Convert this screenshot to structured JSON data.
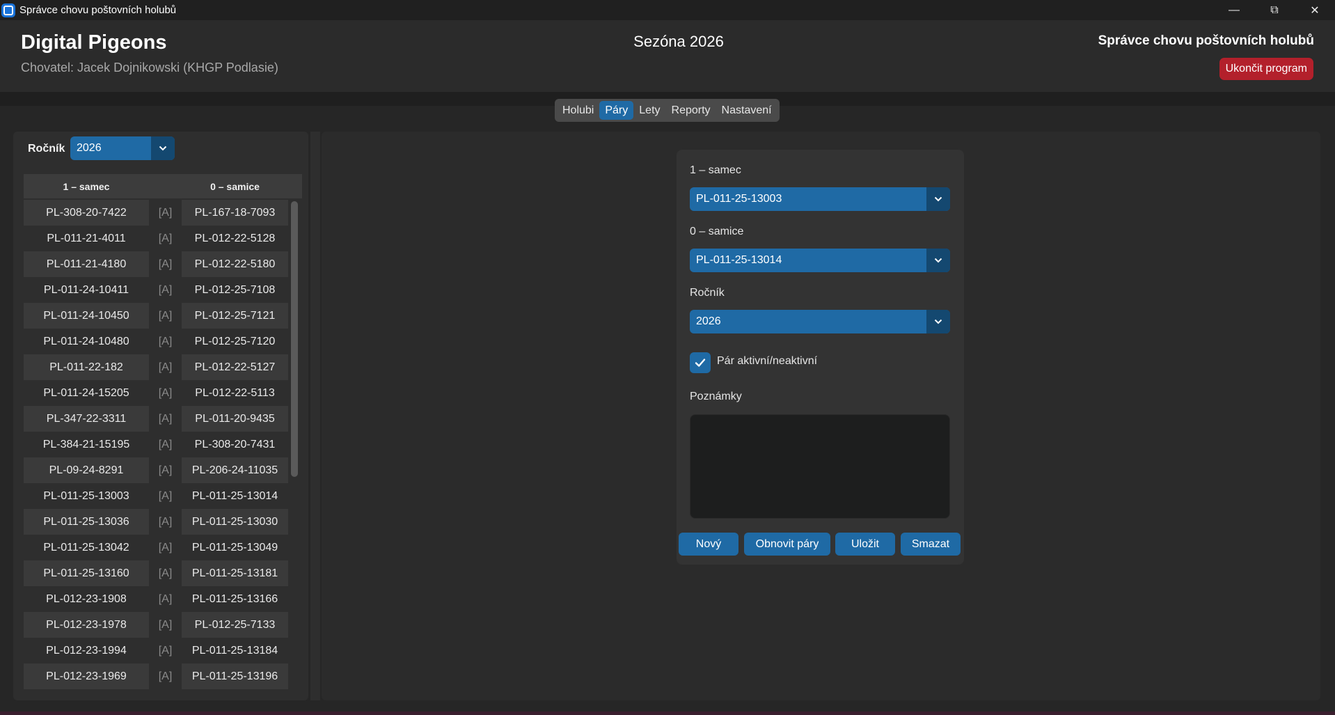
{
  "window": {
    "title": "Správce chovu poštovních holubů"
  },
  "header": {
    "brand": "Digital Pigeons",
    "breeder": "Chovatel: Jacek Dojnikowski (KHGP Podlasie)",
    "season": "Sezóna 2026",
    "app_title": "Správce chovu poštovních holubů",
    "exit_label": "Ukončit program"
  },
  "tabs": [
    {
      "label": "Holubi",
      "active": false
    },
    {
      "label": "Páry",
      "active": true
    },
    {
      "label": "Lety",
      "active": false
    },
    {
      "label": "Reporty",
      "active": false
    },
    {
      "label": "Nastavení",
      "active": false
    }
  ],
  "filter": {
    "label": "Ročník",
    "value": "2026"
  },
  "table": {
    "headers": [
      "1 – samec",
      "0 – samice"
    ],
    "rows": [
      [
        "PL-308-20-7422",
        "[A]",
        "PL-167-18-7093"
      ],
      [
        "PL-011-21-4011",
        "[A]",
        "PL-012-22-5128"
      ],
      [
        "PL-011-21-4180",
        "[A]",
        "PL-012-22-5180"
      ],
      [
        "PL-011-24-10411",
        "[A]",
        "PL-012-25-7108"
      ],
      [
        "PL-011-24-10450",
        "[A]",
        "PL-012-25-7121"
      ],
      [
        "PL-011-24-10480",
        "[A]",
        "PL-012-25-7120"
      ],
      [
        "PL-011-22-182",
        "[A]",
        "PL-012-22-5127"
      ],
      [
        "PL-011-24-15205",
        "[A]",
        "PL-012-22-5113"
      ],
      [
        "PL-347-22-3311",
        "[A]",
        "PL-011-20-9435"
      ],
      [
        "PL-384-21-15195",
        "[A]",
        "PL-308-20-7431"
      ],
      [
        "PL-09-24-8291",
        "[A]",
        "PL-206-24-11035"
      ],
      [
        "PL-011-25-13003",
        "[A]",
        "PL-011-25-13014"
      ],
      [
        "PL-011-25-13036",
        "[A]",
        "PL-011-25-13030"
      ],
      [
        "PL-011-25-13042",
        "[A]",
        "PL-011-25-13049"
      ],
      [
        "PL-011-25-13160",
        "[A]",
        "PL-011-25-13181"
      ],
      [
        "PL-012-23-1908",
        "[A]",
        "PL-011-25-13166"
      ],
      [
        "PL-012-23-1978",
        "[A]",
        "PL-012-25-7133"
      ],
      [
        "PL-012-23-1994",
        "[A]",
        "PL-011-25-13184"
      ],
      [
        "PL-012-23-1969",
        "[A]",
        "PL-011-25-13196"
      ]
    ]
  },
  "form": {
    "male_label": "1 – samec",
    "male_value": "PL-011-25-13003",
    "female_label": "0 – samice",
    "female_value": "PL-011-25-13014",
    "year_label": "Ročník",
    "year_value": "2026",
    "active_label": "Pár aktivní/neaktivní",
    "active_checked": true,
    "notes_label": "Poznámky",
    "notes_value": "",
    "buttons": {
      "new": "Nový",
      "refresh": "Obnovit páry",
      "save": "Uložit",
      "delete": "Smazat"
    }
  },
  "colors": {
    "accent": "#1f6aa5",
    "accent_dark": "#144870",
    "danger": "#b3202b",
    "background": "#262626"
  }
}
